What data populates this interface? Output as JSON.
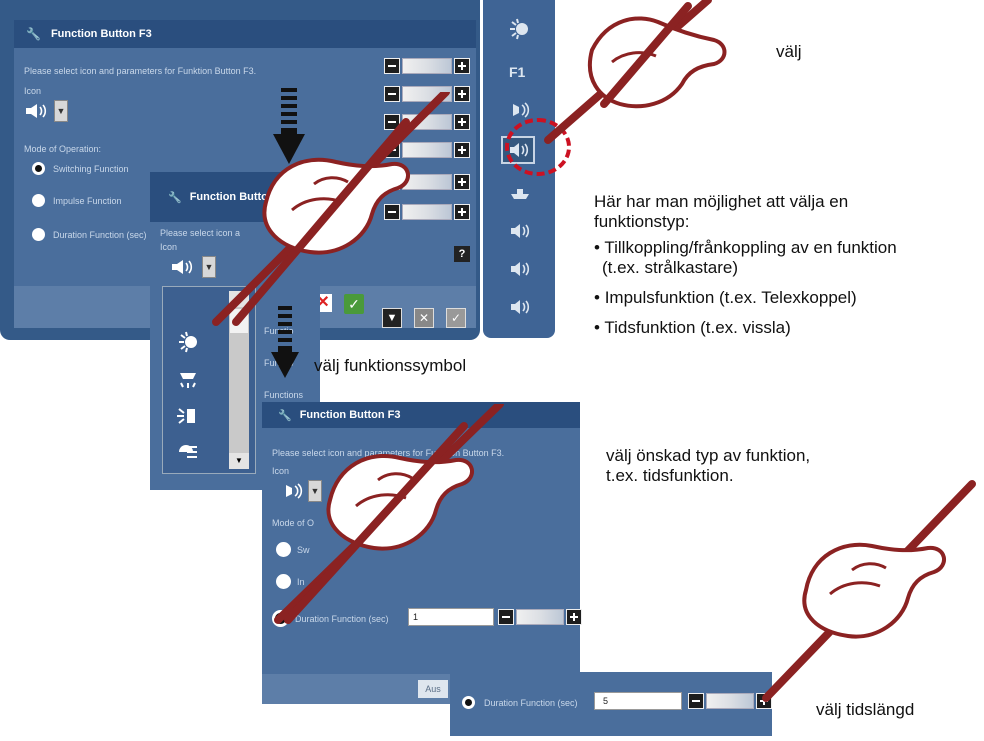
{
  "dialog": {
    "title": "Function Button F3",
    "instruction": "Please select icon and parameters for Funktion Button F3.",
    "icon_label": "Icon",
    "mode_label": "Mode of Operation:",
    "options": [
      "Switching Function",
      "Impulse Function",
      "Duration Function (sec)"
    ]
  },
  "dialog2": {
    "title": "Function Button",
    "instruction": "Please select icon a",
    "icon_label": "Icon",
    "hidden_texts": [
      "Functio",
      "Functio",
      "Functions"
    ]
  },
  "dialog3": {
    "title": "Function Button F3",
    "instruction": "Please select icon and parameters for Funktion Button F3.",
    "icon_label": "Icon",
    "mode_label": "Mode of O",
    "option_partial_1": "Sw",
    "option_partial_2": "In",
    "option_label": "Duration Function (sec)",
    "duration_value": "1",
    "footer_btn": "Aus"
  },
  "strip": {
    "option_label": "Duration Function (sec)",
    "duration_value": "5"
  },
  "sidebar": {
    "f1_label": "F1",
    "help_label": "?"
  },
  "annotations": {
    "valj": "välj",
    "valj_symbol": "välj funktionssymbol",
    "intro_1": "Här har man möjlighet att välja en",
    "intro_2": "funktionstyp:",
    "bullets": [
      {
        "line1": "Tillkoppling/frånkoppling av en funktion",
        "line2": "(t.ex. strålkastare)"
      },
      {
        "line1": "Impulsfunktion (t.ex. Telexkoppel)",
        "line2": ""
      },
      {
        "line1": "Tidsfunktion (t.ex. vissla)",
        "line2": ""
      }
    ],
    "valj_typ_1": "välj önskad typ av funktion,",
    "valj_typ_2": "t.ex. tidsfunktion.",
    "valj_tid": "välj tidslängd"
  },
  "colors": {
    "panel": "#4a6e9c",
    "titlebar": "#2a4e7e",
    "sidebar": "#3f6495",
    "pen": "#8b2222",
    "highlight": "#cc1122"
  },
  "icons": [
    "wrench-icon",
    "horn-icon",
    "dropdown-arrow-icon",
    "light-icon",
    "f1-icon",
    "bell-icon",
    "ship-icon",
    "hand-pointer-illustration",
    "down-arrow-indicator-icon",
    "save-icon",
    "cancel-icon",
    "confirm-icon",
    "help-icon"
  ]
}
